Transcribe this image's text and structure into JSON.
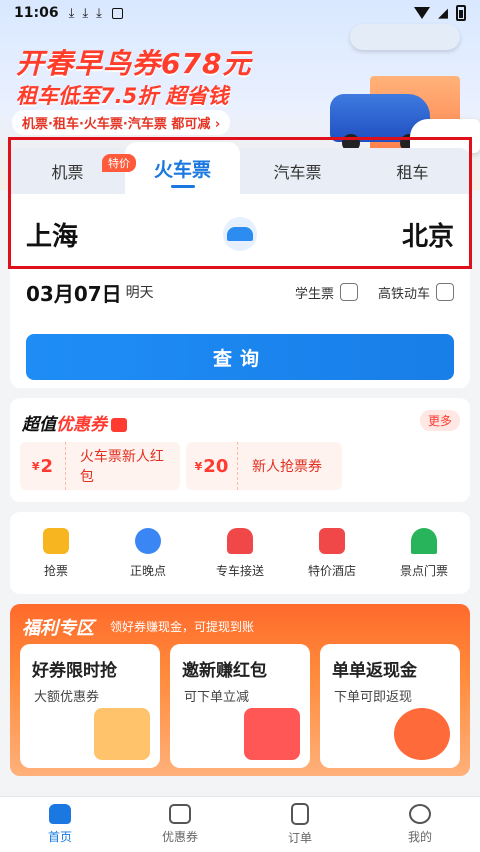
{
  "status_bar": {
    "time": "11:06",
    "download_icons": [
      "download-icon",
      "download-icon",
      "download-icon"
    ],
    "app_icon": "A"
  },
  "banner": {
    "line1": "开春早鸟券678元",
    "line2": "租车低至7.5折 超省钱",
    "line3": "机票·租车·火车票·汽车票 都可减 ›"
  },
  "tabs": [
    {
      "label": "机票",
      "badge": "特价"
    },
    {
      "label": "火车票",
      "active": true
    },
    {
      "label": "汽车票"
    },
    {
      "label": "租车"
    }
  ],
  "route": {
    "from": "上海",
    "to": "北京"
  },
  "date": {
    "value": "03月07日",
    "day": "明天"
  },
  "options": {
    "student": "学生票",
    "highspeed": "高铁动车"
  },
  "search_button": "查询",
  "coupons": {
    "title_prefix": "超值",
    "title_emph": "优惠券",
    "more": "更多",
    "items": [
      {
        "currency": "¥",
        "amount": "2",
        "label": "火车票新人红包"
      },
      {
        "currency": "¥",
        "amount": "20",
        "label": "新人抢票券"
      }
    ]
  },
  "quick_actions": [
    {
      "label": "抢票",
      "icon": "ticket-grab-icon",
      "color": "#f7b620"
    },
    {
      "label": "正晚点",
      "icon": "clock-icon",
      "color": "#3a86f5"
    },
    {
      "label": "专车接送",
      "icon": "car-icon",
      "color": "#f04848"
    },
    {
      "label": "特价酒店",
      "icon": "hotel-icon",
      "color": "#f04848"
    },
    {
      "label": "景点门票",
      "icon": "mountain-icon",
      "color": "#28b45a"
    }
  ],
  "welfare": {
    "title": "福利专区",
    "subtitle": "领好券赚现金，可提现到账",
    "cards": [
      {
        "title": "好券限时抢",
        "sub": "大额优惠券",
        "icon": "coupon-ticket-icon",
        "color": "#ffc46b"
      },
      {
        "title": "邀新赚红包",
        "sub": "可下单立减",
        "icon": "red-envelope-icon",
        "color": "#ff5656"
      },
      {
        "title": "单单返现金",
        "sub": "下单可即返现",
        "icon": "cashback-icon",
        "color": "#ff6a3a"
      }
    ]
  },
  "nav": [
    {
      "label": "首页",
      "icon": "home-icon",
      "active": true
    },
    {
      "label": "优惠券",
      "icon": "coupon-icon"
    },
    {
      "label": "订单",
      "icon": "order-icon"
    },
    {
      "label": "我的",
      "icon": "profile-icon"
    }
  ]
}
